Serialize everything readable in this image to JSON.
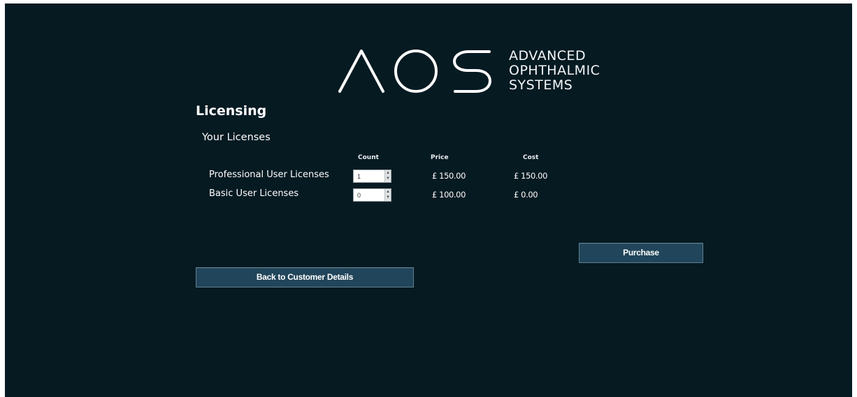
{
  "logo": {
    "mark": "AOS",
    "line1": "ADVANCED",
    "line2": "OPHTHALMIC",
    "line3": "SYSTEMS"
  },
  "page": {
    "title": "Licensing",
    "section_title": "Your Licenses"
  },
  "table": {
    "headers": {
      "count": "Count",
      "price": "Price",
      "cost": "Cost"
    },
    "rows": [
      {
        "label": "Professional User Licenses",
        "count": "1",
        "price": "£ 150.00",
        "cost": "£ 150.00"
      },
      {
        "label": "Basic User Licenses",
        "count": "0",
        "price": "£ 100.00",
        "cost": "£ 0.00"
      }
    ]
  },
  "buttons": {
    "purchase": "Purchase",
    "back": "Back to Customer Details"
  },
  "colors": {
    "background": "#061a22",
    "button": "#21455a",
    "button_border": "#5f7f90"
  }
}
